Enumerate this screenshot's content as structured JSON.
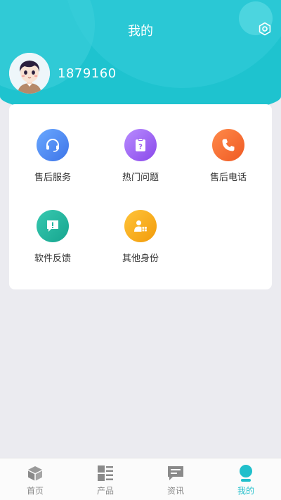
{
  "header": {
    "title": "我的",
    "settings_icon": "settings-hexagon-icon",
    "user_id": "1879160",
    "accent_color": "#1ec3cf"
  },
  "services": [
    {
      "label": "售后服务",
      "icon": "headset-icon",
      "color": "#4a8cf0"
    },
    {
      "label": "热门问题",
      "icon": "question-clipboard-icon",
      "color": "#9b5cf0"
    },
    {
      "label": "售后电话",
      "icon": "phone-icon",
      "color": "#f5692e"
    },
    {
      "label": "软件反馈",
      "icon": "feedback-message-icon",
      "color": "#22b5a0"
    },
    {
      "label": "其他身份",
      "icon": "identity-icon",
      "color": "#f5b212"
    }
  ],
  "tabbar": {
    "items": [
      {
        "label": "首页",
        "icon": "cube-icon"
      },
      {
        "label": "产品",
        "icon": "product-list-icon"
      },
      {
        "label": "资讯",
        "icon": "news-message-icon"
      },
      {
        "label": "我的",
        "icon": "person-icon",
        "active": true
      }
    ],
    "active_color": "#20bfcb"
  }
}
